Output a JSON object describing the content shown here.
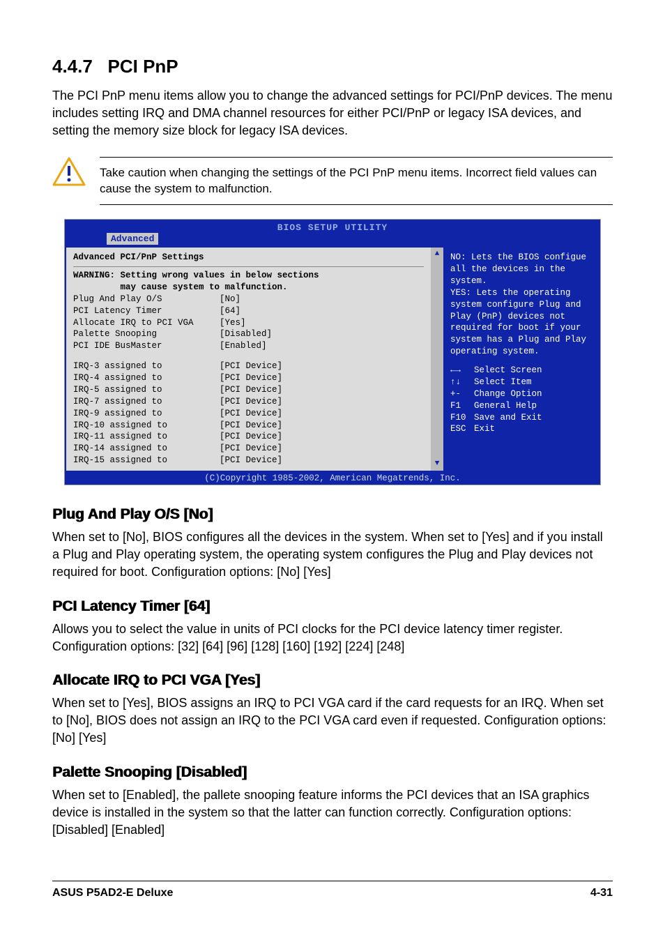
{
  "section": {
    "number": "4.4.7",
    "title": "PCI PnP",
    "intro": "The PCI PnP menu items allow you to change the advanced settings for PCI/PnP devices. The menu includes setting IRQ and DMA channel resources for either PCI/PnP or legacy ISA devices, and setting the memory size block for legacy ISA devices."
  },
  "caution": "Take caution when changing the settings of the PCI PnP menu items. Incorrect field values can cause the system to malfunction.",
  "bios": {
    "header_title": "BIOS SETUP UTILITY",
    "tab": "Advanced",
    "panel_title": "Advanced PCI/PnP Settings",
    "warning": "WARNING: Setting wrong values in below sections\n         may cause system to malfunction.",
    "settings": [
      {
        "label": "Plug And Play O/S",
        "value": "[No]"
      },
      {
        "label": "PCI Latency Timer",
        "value": "[64]"
      },
      {
        "label": "Allocate IRQ to PCI VGA",
        "value": "[Yes]"
      },
      {
        "label": "Palette Snooping",
        "value": "[Disabled]"
      },
      {
        "label": "PCI IDE BusMaster",
        "value": "[Enabled]"
      }
    ],
    "irqs": [
      {
        "label": "IRQ-3 assigned to",
        "value": "[PCI Device]"
      },
      {
        "label": "IRQ-4 assigned to",
        "value": "[PCI Device]"
      },
      {
        "label": "IRQ-5 assigned to",
        "value": "[PCI Device]"
      },
      {
        "label": "IRQ-7 assigned to",
        "value": "[PCI Device]"
      },
      {
        "label": "IRQ-9 assigned to",
        "value": "[PCI Device]"
      },
      {
        "label": "IRQ-10 assigned to",
        "value": "[PCI Device]"
      },
      {
        "label": "IRQ-11 assigned to",
        "value": "[PCI Device]"
      },
      {
        "label": "IRQ-14 assigned to",
        "value": "[PCI Device]"
      },
      {
        "label": "IRQ-15 assigned to",
        "value": "[PCI Device]"
      }
    ],
    "help_text": "NO: Lets the BIOS configue all the devices in the system.\nYES: Lets the operating system configure Plug and Play (PnP) devices not required for boot if your system has a Plug and Play operating system.",
    "keys": [
      {
        "icon": "←→",
        "text": "Select Screen"
      },
      {
        "icon": "↑↓",
        "text": "Select Item"
      },
      {
        "icon": "+-",
        "text": "Change Option"
      },
      {
        "icon": "F1",
        "text": "General Help"
      },
      {
        "icon": "F10",
        "text": "Save and Exit"
      },
      {
        "icon": "ESC",
        "text": "Exit"
      }
    ],
    "footer": "(C)Copyright 1985-2002, American Megatrends, Inc."
  },
  "subsections": [
    {
      "title": "Plug And Play O/S [No]",
      "text": "When set to [No], BIOS configures all the devices in the system. When set to [Yes] and if you install a Plug and Play operating system, the operating system configures the Plug and Play devices not required for boot. Configuration options: [No] [Yes]"
    },
    {
      "title": "PCI Latency Timer [64]",
      "text": "Allows you to select the value in units of PCI clocks for the PCI device latency timer register. Configuration options: [32] [64] [96] [128] [160] [192] [224] [248]"
    },
    {
      "title": "Allocate IRQ to PCI VGA [Yes]",
      "text": "When set to [Yes], BIOS assigns an IRQ to PCI VGA card if the card requests for an IRQ. When set to [No], BIOS does not assign an IRQ to the PCI VGA card even if requested. Configuration options: [No] [Yes]"
    },
    {
      "title": "Palette Snooping [Disabled]",
      "text": "When set to [Enabled], the pallete snooping feature informs the PCI devices that an ISA graphics device is installed in the system so that the latter can function correctly. Configuration options: [Disabled] [Enabled]"
    }
  ],
  "footer": {
    "left": "ASUS P5AD2-E Deluxe",
    "right": "4-31"
  }
}
